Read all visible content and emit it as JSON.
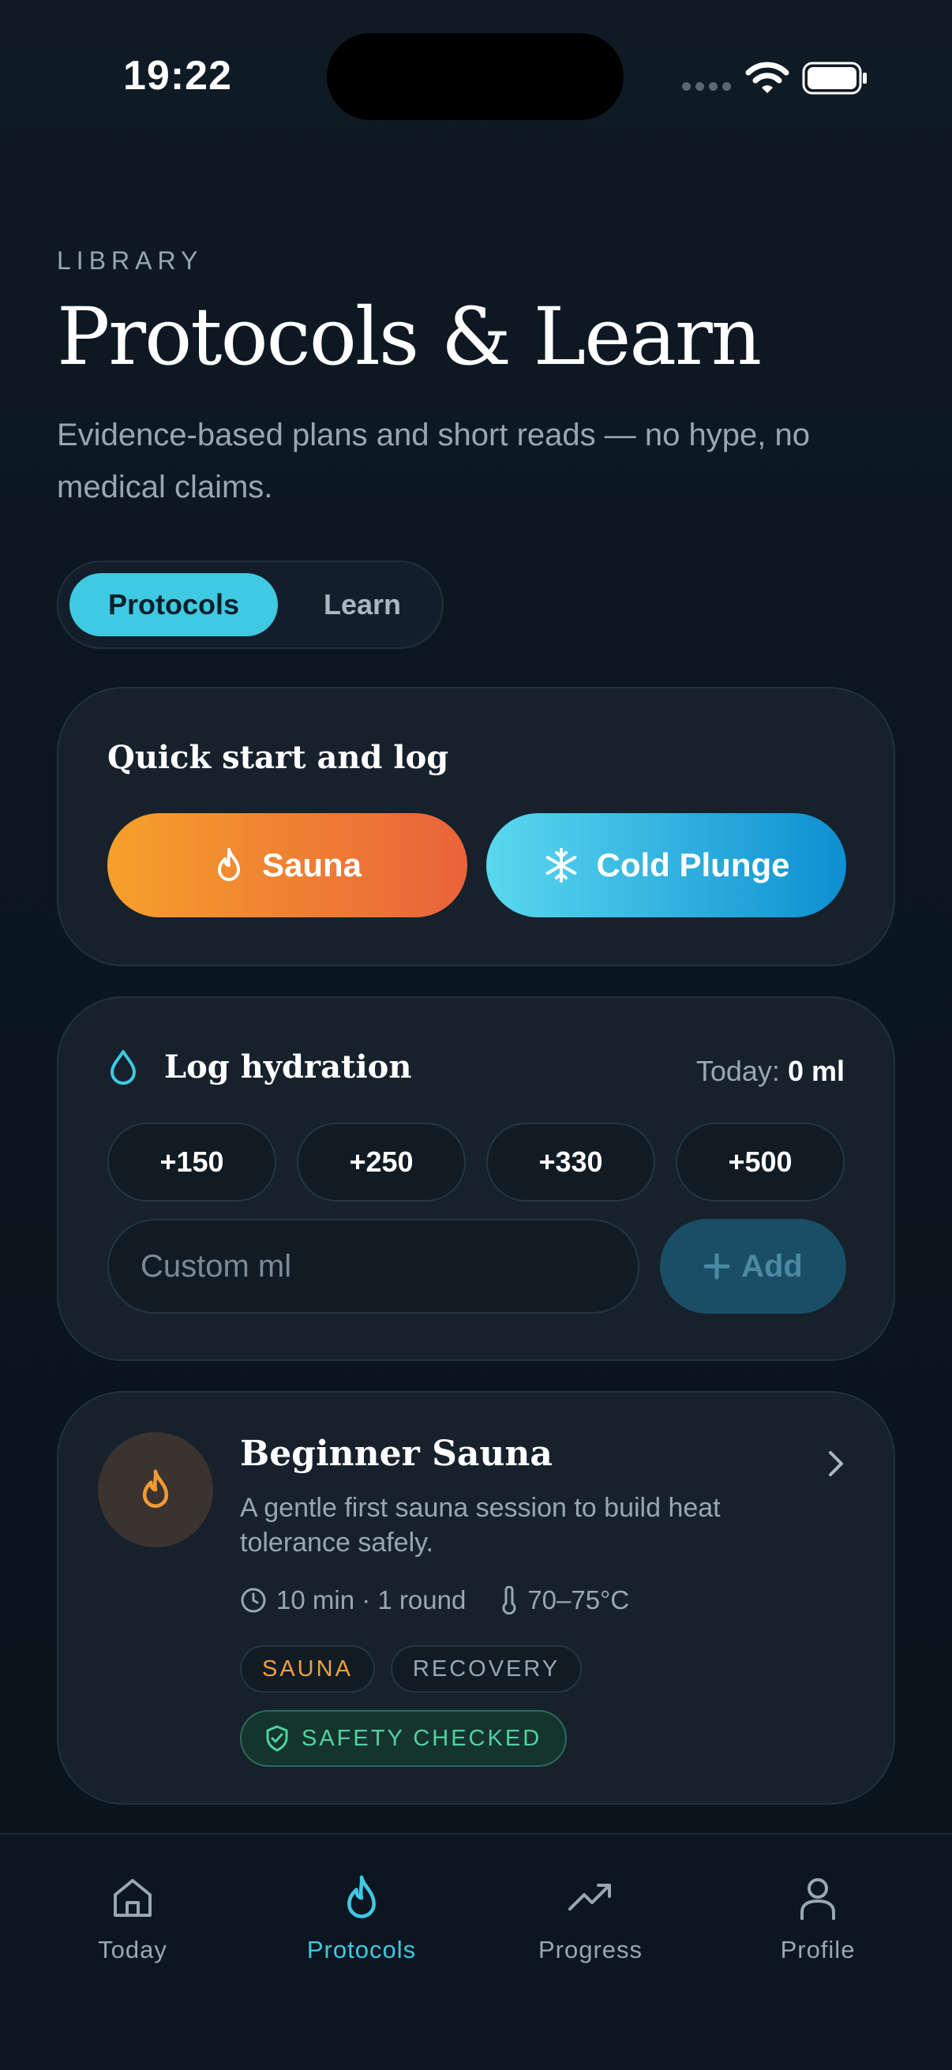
{
  "status_bar": {
    "time": "19:22"
  },
  "header": {
    "eyebrow": "LIBRARY",
    "title": "Protocols & Learn",
    "subtitle": "Evidence-based plans and short reads — no hype, no medical claims."
  },
  "segmented": {
    "active": "Protocols",
    "inactive": "Learn"
  },
  "quick_start": {
    "heading": "Quick start and log",
    "sauna_label": "Sauna",
    "cold_label": "Cold Plunge"
  },
  "hydration": {
    "heading": "Log hydration",
    "today_label": "Today:",
    "today_value": "0 ml",
    "amounts": [
      "+150",
      "+250",
      "+330",
      "+500"
    ],
    "custom_placeholder": "Custom ml",
    "add_label": "Add"
  },
  "protocol_card": {
    "title": "Beginner Sauna",
    "description": "A gentle first sauna session to build heat tolerance safely.",
    "duration": "10 min · 1 round",
    "temperature": "70–75°C",
    "tags": [
      "SAUNA",
      "RECOVERY"
    ],
    "safety": "SAFETY CHECKED"
  },
  "tabbar": {
    "items": [
      {
        "label": "Today",
        "icon": "home-icon"
      },
      {
        "label": "Protocols",
        "icon": "flame-icon"
      },
      {
        "label": "Progress",
        "icon": "trending-up-icon"
      },
      {
        "label": "Profile",
        "icon": "user-icon"
      }
    ],
    "active": "Protocols"
  },
  "colors": {
    "accent": "#3fc9e3",
    "sauna_gradient": [
      "#f6a02a",
      "#e9633b"
    ],
    "cold_gradient": [
      "#5ad8ef",
      "#0d8fd1"
    ],
    "safety": "#4fd3a0",
    "background": "#0b1620"
  }
}
